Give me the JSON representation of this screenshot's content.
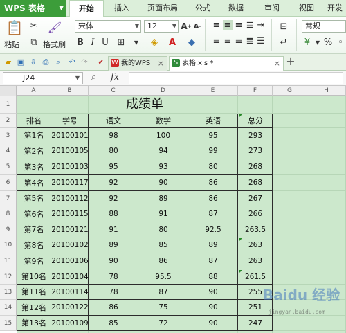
{
  "app": {
    "title": "WPS 表格"
  },
  "menu": {
    "tabs": [
      {
        "label": "开始",
        "active": true
      },
      {
        "label": "插入",
        "active": false
      },
      {
        "label": "页面布局",
        "active": false
      },
      {
        "label": "公式",
        "active": false
      },
      {
        "label": "数据",
        "active": false
      },
      {
        "label": "审阅",
        "active": false
      },
      {
        "label": "视图",
        "active": false
      },
      {
        "label": "开发",
        "active": false
      }
    ]
  },
  "ribbon": {
    "paste_label": "粘贴",
    "format_painter_label": "格式刷",
    "font_name": "宋体",
    "font_size": "12",
    "number_format": "常规"
  },
  "doc_tabs": [
    {
      "label": "我的WPS",
      "active": false
    },
    {
      "label": "表格.xls *",
      "active": true
    }
  ],
  "formula_bar": {
    "cell_ref": "J24",
    "fx_label": "fx",
    "value": ""
  },
  "columns": [
    "A",
    "B",
    "C",
    "D",
    "E",
    "F",
    "G",
    "H"
  ],
  "rows": [
    "1",
    "2",
    "3",
    "4",
    "5",
    "6",
    "7",
    "8",
    "9",
    "10",
    "11",
    "12",
    "13",
    "14",
    "15"
  ],
  "sheet": {
    "title": "成绩单",
    "headers": [
      "排名",
      "学号",
      "语文",
      "数学",
      "英语",
      "总分"
    ],
    "records": [
      [
        "第1名",
        "20100101",
        "98",
        "100",
        "95",
        "293"
      ],
      [
        "第2名",
        "20100105",
        "80",
        "94",
        "99",
        "273"
      ],
      [
        "第3名",
        "20100103",
        "95",
        "93",
        "80",
        "268"
      ],
      [
        "第4名",
        "20100117",
        "92",
        "90",
        "86",
        "268"
      ],
      [
        "第5名",
        "20100112",
        "92",
        "89",
        "86",
        "267"
      ],
      [
        "第6名",
        "20100115",
        "88",
        "91",
        "87",
        "266"
      ],
      [
        "第7名",
        "20100121",
        "91",
        "80",
        "92.5",
        "263.5"
      ],
      [
        "第8名",
        "20100102",
        "89",
        "85",
        "89",
        "263"
      ],
      [
        "第9名",
        "20100106",
        "90",
        "86",
        "87",
        "263"
      ],
      [
        "第10名",
        "20100104",
        "78",
        "95.5",
        "88",
        "261.5"
      ],
      [
        "第11名",
        "20100114",
        "78",
        "87",
        "90",
        "255"
      ],
      [
        "第12名",
        "20100122",
        "86",
        "75",
        "90",
        "251"
      ],
      [
        "第13名",
        "20100109",
        "85",
        "72",
        "90",
        "247"
      ]
    ]
  },
  "watermark": {
    "logo": "Baidu 经验",
    "sub": "jingyan.baidu.com"
  },
  "colors": {
    "accent": "#3c9d3a",
    "grid_bg": "#cce8cc",
    "ribbon_bg": "#dcefda"
  }
}
